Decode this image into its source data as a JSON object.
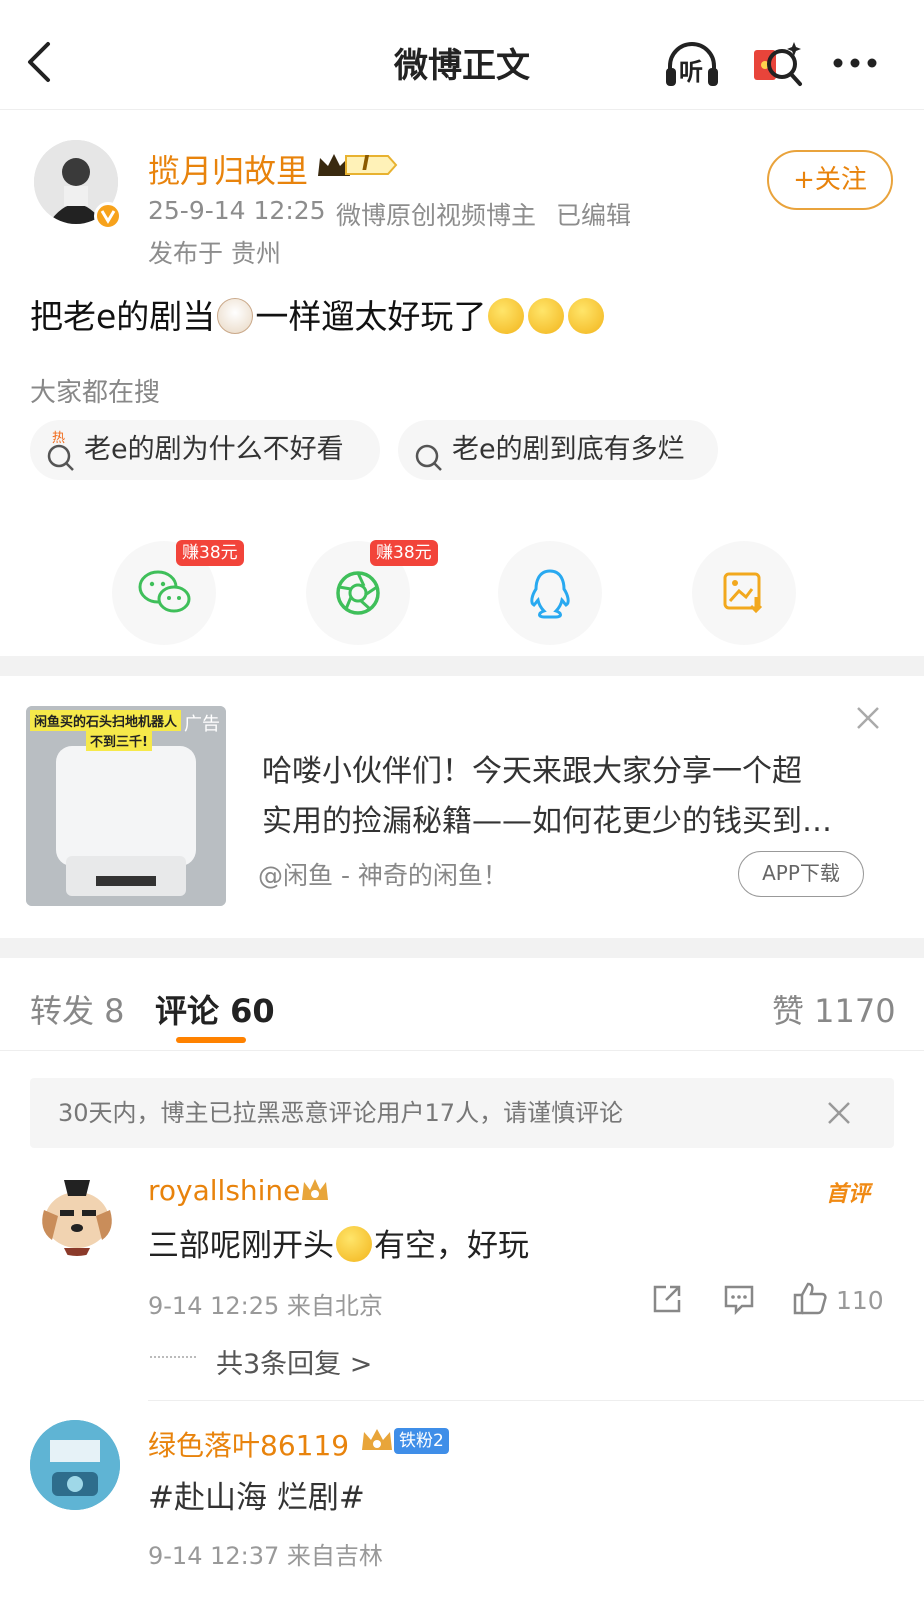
{
  "nav": {
    "title": "微博正文",
    "listen_label": "听"
  },
  "post": {
    "author": "揽月归故里",
    "vip_badge": "I",
    "time": "25-9-14 12:25",
    "source": "微博原创视频博主",
    "edited": "已编辑",
    "location": "发布于 贵州",
    "follow_label": "+关注",
    "text_1": "把老e的剧当",
    "text_2": "一样遛太好玩了"
  },
  "search": {
    "title": "大家都在搜",
    "hot_tag": "热",
    "items": [
      "老e的剧为什么不好看",
      "老e的剧到底有多烂"
    ]
  },
  "share": {
    "earn_wechat": "赚38元",
    "earn_moments": "赚38元"
  },
  "ad": {
    "image_line1": "闲鱼买的石头扫地机器人",
    "image_line2": "不到三千!",
    "ad_tag": "广告",
    "text_line1": "哈喽小伙伴们！今天来跟大家分享一个超",
    "text_line2": "实用的捡漏秘籍——如何花更少的钱买到…",
    "source": "@闲鱼 - 神奇的闲鱼！",
    "cta": "APP下载"
  },
  "tabs": {
    "repost": "转发 8",
    "comments": "评论 60",
    "likes": "赞 1170"
  },
  "notice": "30天内，博主已拉黑恶意评论用户17人，请谨慎评论",
  "comments": [
    {
      "user": "royallshine",
      "tag": "首评",
      "text_1": "三部呢刚开头",
      "text_2": "有空，好玩",
      "meta": "9-14 12:25  来自北京",
      "likes": "110",
      "replies": "共3条回复 >"
    },
    {
      "user": "绿色落叶86119",
      "fan_badge": "铁粉2",
      "text": "#赴山海 烂剧#",
      "meta": "9-14 12:37  来自吉林"
    }
  ],
  "colors": {
    "orange": "#e8830c",
    "accent_bar": "#ff8200",
    "red_badge": "#f2443a"
  }
}
